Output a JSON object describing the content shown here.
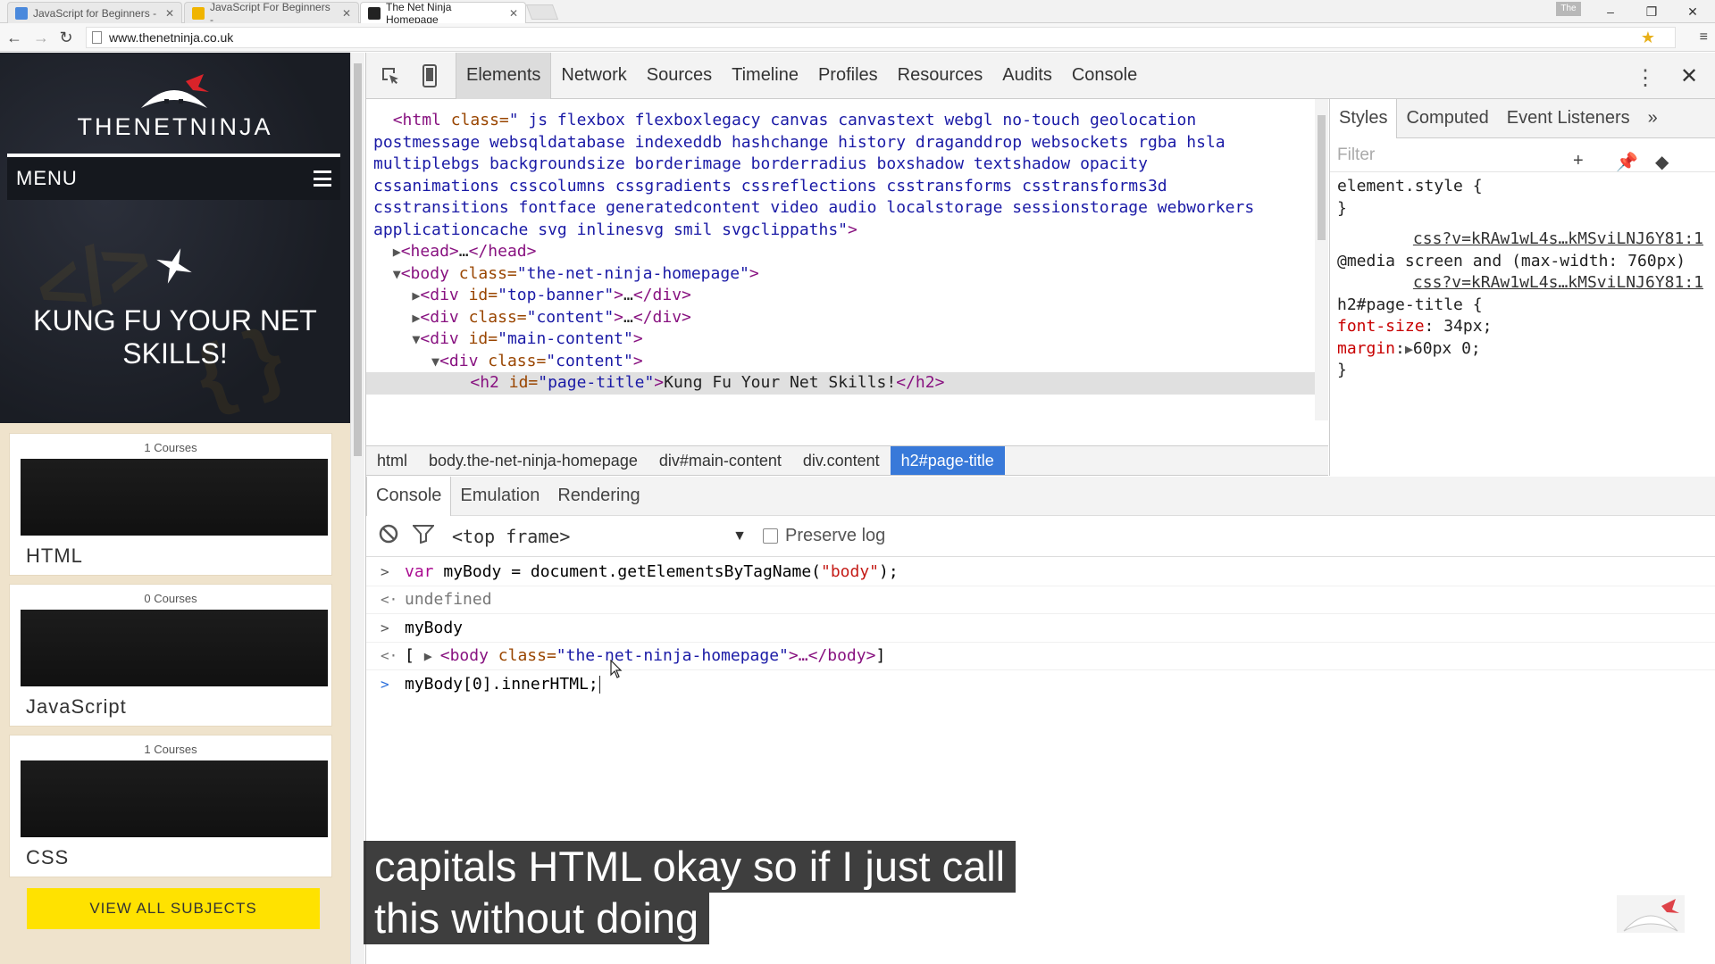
{
  "browser": {
    "tabs": [
      {
        "title": "JavaScript for Beginners - ",
        "favicon_color": "#4a89dc",
        "active": false
      },
      {
        "title": "JavaScript For Beginners - ",
        "favicon_color": "#f0b400",
        "active": false
      },
      {
        "title": "The Net Ninja Homepage",
        "favicon_color": "#222222",
        "active": true
      }
    ],
    "profile_badge": "The",
    "url": "www.thenetninja.co.uk"
  },
  "site": {
    "logo": "THENETNINJA",
    "menu_label": "MENU",
    "hero_title": "KUNG FU YOUR NET SKILLS!",
    "courses": [
      {
        "count": "1 Courses",
        "name": "HTML"
      },
      {
        "count": "0 Courses",
        "name": "JavaScript"
      },
      {
        "count": "1 Courses",
        "name": "CSS"
      }
    ],
    "view_all": "VIEW ALL SUBJECTS"
  },
  "devtools": {
    "tabs": [
      "Elements",
      "Network",
      "Sources",
      "Timeline",
      "Profiles",
      "Resources",
      "Audits",
      "Console"
    ],
    "active_tab": "Elements",
    "dom": {
      "html_classes": [
        "\" js flexbox flexboxlegacy canvas canvastext webgl no-touch geolocation",
        "postmessage websqldatabase indexeddb hashchange history draganddrop websockets rgba hsla",
        "multiplebgs backgroundsize borderimage borderradius boxshadow textshadow opacity",
        "cssanimations csscolumns cssgradients cssreflections csstransforms csstransforms3d",
        "csstransitions fontface generatedcontent video audio localstorage sessionstorage webworkers",
        "applicationcache svg inlinesvg smil svgclippaths\""
      ],
      "body_class": "\"the-net-ninja-homepage\"",
      "top_banner_id": "\"top-banner\"",
      "content_class": "\"content\"",
      "main_content_id": "\"main-content\"",
      "page_title_id": "\"page-title\"",
      "page_title_text": "Kung Fu Your Net Skills!"
    },
    "breadcrumbs": [
      "html",
      "body.the-net-ninja-homepage",
      "div#main-content",
      "div.content",
      "h2#page-title"
    ],
    "styles": {
      "tabs": [
        "Styles",
        "Computed",
        "Event Listeners",
        "»"
      ],
      "filter_placeholder": "Filter",
      "element_style": "element.style {",
      "close_brace": "}",
      "source_link": "css?v=kRAw1wL4s…kMSviLNJ6Y81:1",
      "media_query": "@media screen and (max-width: 760px)",
      "selector": "h2#page-title {",
      "rules": [
        {
          "prop": "font-size",
          "value": "34px;"
        },
        {
          "prop": "margin",
          "value": "60px 0;"
        }
      ]
    },
    "drawer_tabs": [
      "Console",
      "Emulation",
      "Rendering"
    ],
    "console": {
      "frame": "<top frame>",
      "preserve_log": "Preserve log",
      "lines": [
        {
          "kind": "input",
          "text_var": "var",
          "text_mid": " myBody = document.getElementsByTagName(",
          "text_str": "\"body\"",
          "text_end": ");"
        },
        {
          "kind": "output",
          "text": "undefined"
        },
        {
          "kind": "input",
          "text": "myBody"
        },
        {
          "kind": "output",
          "text_open": "[ ",
          "text_tag": "<body",
          "text_attr": " class=",
          "text_val": "\"the-net-ninja-homepage\"",
          "text_close": ">…</body>",
          "text_end": "]"
        },
        {
          "kind": "current",
          "text": "myBody[0].innerHTML;"
        }
      ]
    }
  },
  "caption": {
    "line1": "capitals HTML okay so if I just call",
    "line2": "this without doing"
  }
}
